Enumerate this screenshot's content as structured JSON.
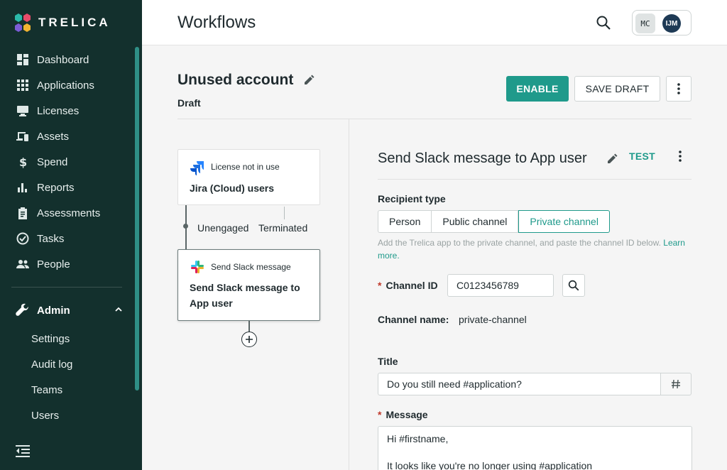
{
  "app": {
    "brand": "TRELICA",
    "colors": {
      "sidebar": "#13302d",
      "accent": "#1f9a8b"
    }
  },
  "sidebar": {
    "items": [
      {
        "label": "Dashboard",
        "icon": "dashboard-icon"
      },
      {
        "label": "Applications",
        "icon": "apps-grid-icon"
      },
      {
        "label": "Licenses",
        "icon": "licenses-icon"
      },
      {
        "label": "Assets",
        "icon": "devices-icon"
      },
      {
        "label": "Spend",
        "icon": "dollar-icon"
      },
      {
        "label": "Reports",
        "icon": "bar-chart-icon"
      },
      {
        "label": "Assessments",
        "icon": "clipboard-icon"
      },
      {
        "label": "Tasks",
        "icon": "check-circle-icon"
      },
      {
        "label": "People",
        "icon": "people-icon"
      }
    ],
    "admin": {
      "label": "Admin",
      "icon": "wrench-icon",
      "subitems": [
        "Settings",
        "Audit log",
        "Teams",
        "Users"
      ]
    }
  },
  "header": {
    "title": "Workflows",
    "avatar_1": "MC",
    "avatar_2": "IJM"
  },
  "workflow": {
    "name": "Unused account",
    "status": "Draft",
    "enable_label": "ENABLE",
    "save_draft_label": "SAVE DRAFT"
  },
  "flow": {
    "trigger": {
      "type": "License not in use",
      "name": "Jira (Cloud) users",
      "icon": "jira-icon"
    },
    "branches": [
      "Unengaged",
      "Terminated"
    ],
    "action": {
      "type": "Send Slack message",
      "name": "Send Slack message to App user",
      "icon": "slack-icon"
    }
  },
  "panel": {
    "title": "Send Slack message to App user",
    "test_label": "TEST",
    "recipient_label": "Recipient type",
    "recipient_options": [
      "Person",
      "Public channel",
      "Private channel"
    ],
    "recipient_selected": "Private channel",
    "hint": "Add the Trelica app to the private channel, and paste the channel ID below.",
    "learn_more": "Learn more.",
    "channel_id_label": "Channel ID",
    "channel_id_value": "C0123456789",
    "channel_name_label": "Channel name:",
    "channel_name_value": "private-channel",
    "title_label": "Title",
    "title_value": "Do you still need #application?",
    "message_label": "Message",
    "message_value": "Hi #firstname,\n\nIt looks like you're no longer using #application"
  }
}
